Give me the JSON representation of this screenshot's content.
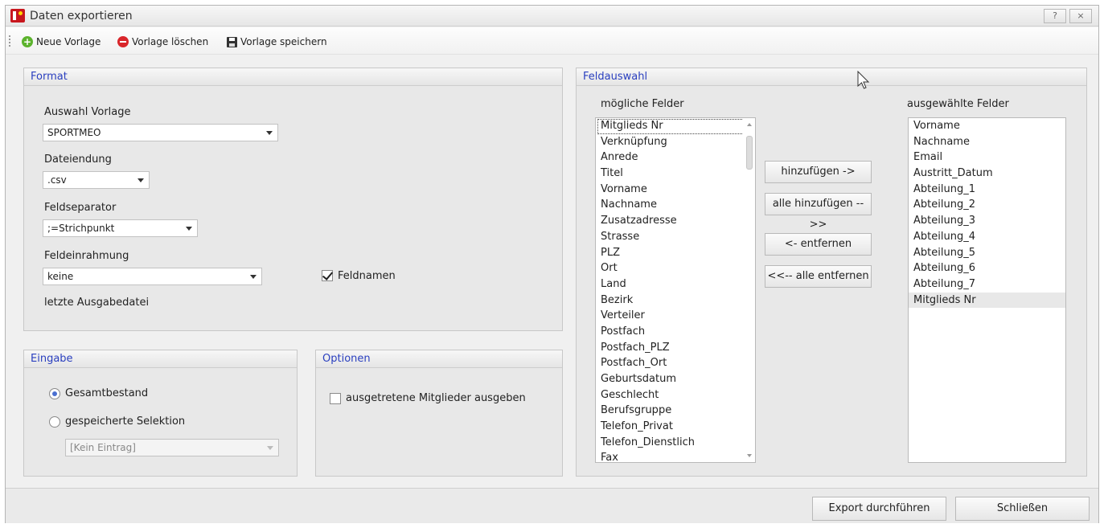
{
  "window": {
    "title": "Daten exportieren",
    "help_label": "?",
    "close_label": "×"
  },
  "toolbar": {
    "new_template": "Neue Vorlage",
    "delete_template": "Vorlage löschen",
    "save_template": "Vorlage speichern"
  },
  "format": {
    "header": "Format",
    "template_label": "Auswahl Vorlage",
    "template_value": "SPORTMEO",
    "extension_label": "Dateiendung",
    "extension_value": ".csv",
    "separator_label": "Feldseparator",
    "separator_value": ";=Strichpunkt",
    "enclosure_label": "Feldeinrahmung",
    "enclosure_value": "keine",
    "fieldnames_label": "Feldnamen",
    "fieldnames_checked": true,
    "last_file_label": "letzte Ausgabedatei"
  },
  "input": {
    "header": "Eingabe",
    "radio_all": "Gesamtbestand",
    "radio_saved": "gespeicherte Selektion",
    "selected": "all",
    "selection_value": "[Kein Eintrag]"
  },
  "options": {
    "header": "Optionen",
    "exited_members_label": "ausgetretene Mitglieder ausgeben",
    "exited_members_checked": false
  },
  "fields": {
    "header": "Feldauswahl",
    "available_label": "mögliche Felder",
    "selected_label": "ausgewählte Felder",
    "available": [
      "Mitglieds Nr",
      "Verknüpfung",
      "Anrede",
      "Titel",
      "Vorname",
      "Nachname",
      "Zusatzadresse",
      "Strasse",
      "PLZ",
      "Ort",
      "Land",
      "Bezirk",
      "Verteiler",
      "Postfach",
      "Postfach_PLZ",
      "Postfach_Ort",
      "Geburtsdatum",
      "Geschlecht",
      "Berufsgruppe",
      "Telefon_Privat",
      "Telefon_Dienstlich",
      "Fax"
    ],
    "selected": [
      "Vorname",
      "Nachname",
      "Email",
      "Austritt_Datum",
      "Abteilung_1",
      "Abteilung_2",
      "Abteilung_3",
      "Abteilung_4",
      "Abteilung_5",
      "Abteilung_6",
      "Abteilung_7",
      "Mitglieds Nr"
    ],
    "add_button": "hinzufügen ->",
    "add_all_button": "alle hinzufügen -->>",
    "remove_button": "<- entfernen",
    "remove_all_button": "<<-- alle entfernen"
  },
  "footer": {
    "export_button": "Export durchführen",
    "close_button": "Schließen"
  }
}
